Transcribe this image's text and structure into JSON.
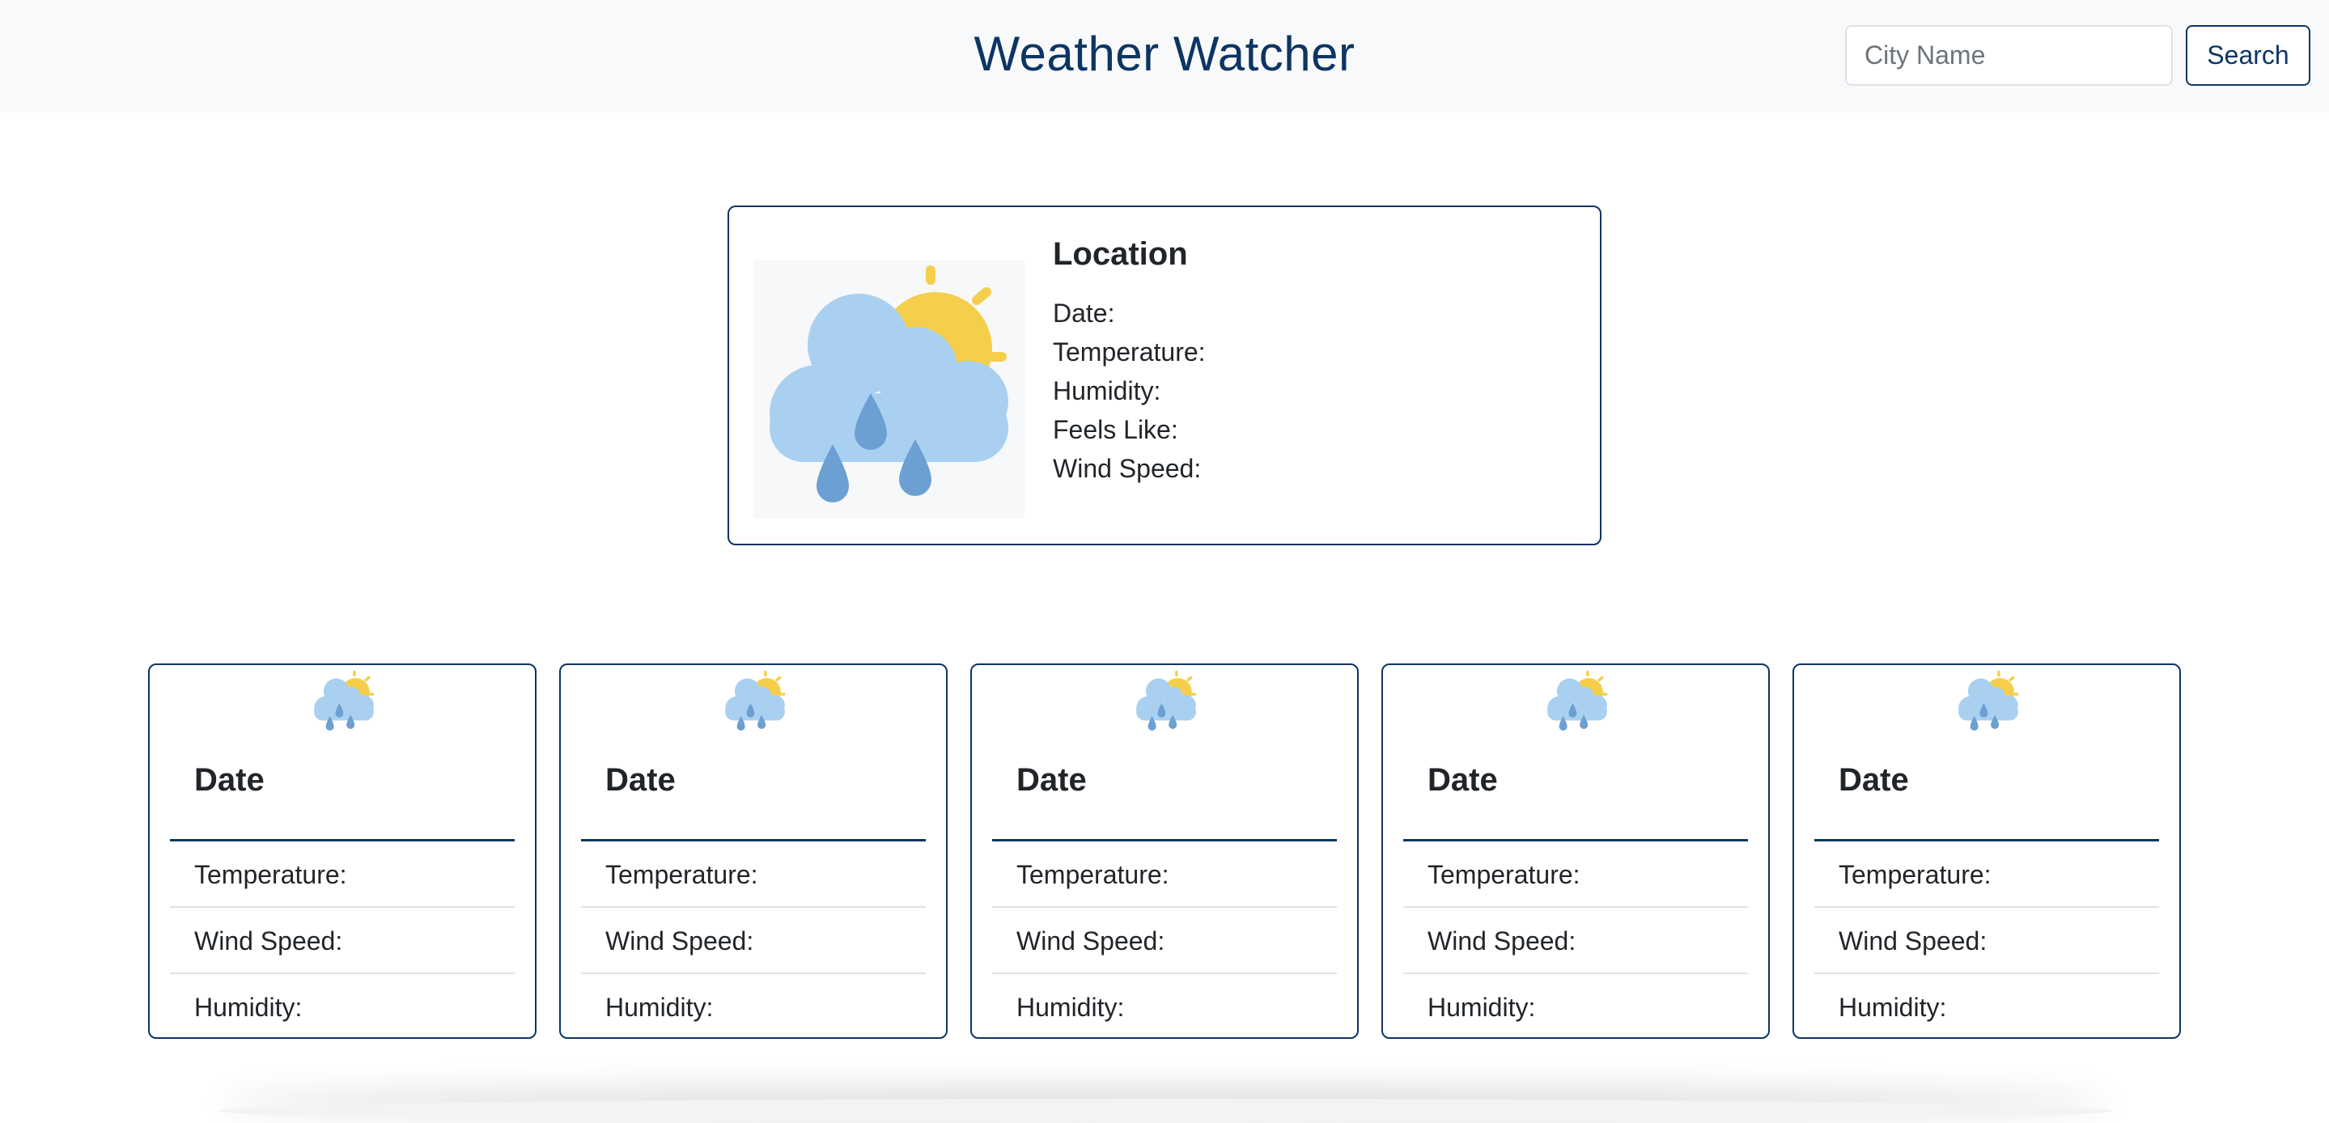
{
  "header": {
    "title": "Weather Watcher",
    "search_placeholder": "City Name",
    "search_button": "Search"
  },
  "current": {
    "location": "Location",
    "icon": "partly-cloudy-rain-icon",
    "rows": [
      "Date:",
      "Temperature:",
      "Humidity:",
      "Feels Like:",
      "Wind Speed:"
    ]
  },
  "forecast": [
    {
      "date": "Date",
      "icon": "partly-cloudy-rain-icon",
      "temperature": "Temperature:",
      "wind_speed": "Wind Speed:",
      "humidity": "Humidity:"
    },
    {
      "date": "Date",
      "icon": "partly-cloudy-rain-icon",
      "temperature": "Temperature:",
      "wind_speed": "Wind Speed:",
      "humidity": "Humidity:"
    },
    {
      "date": "Date",
      "icon": "partly-cloudy-rain-icon",
      "temperature": "Temperature:",
      "wind_speed": "Wind Speed:",
      "humidity": "Humidity:"
    },
    {
      "date": "Date",
      "icon": "partly-cloudy-rain-icon",
      "temperature": "Temperature:",
      "wind_speed": "Wind Speed:",
      "humidity": "Humidity:"
    },
    {
      "date": "Date",
      "icon": "partly-cloudy-rain-icon",
      "temperature": "Temperature:",
      "wind_speed": "Wind Speed:",
      "humidity": "Humidity:"
    }
  ],
  "colors": {
    "accent": "#0d3564",
    "navbar_bg": "#f8f9fa",
    "cloud": "#aad0f1",
    "sun": "#f5cf4c",
    "rain": "#6c9fd2"
  }
}
